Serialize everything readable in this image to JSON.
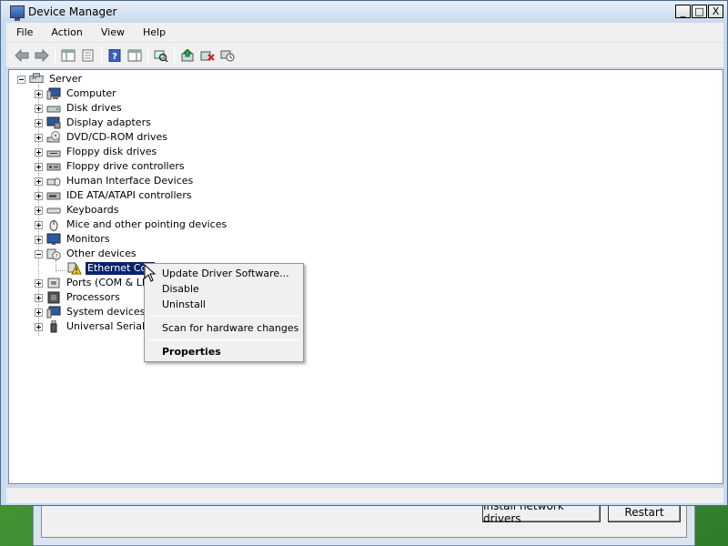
{
  "background_dialog": {
    "install_button": "Install network drivers",
    "restart_button": "Restart"
  },
  "window": {
    "title": "Device Manager",
    "controls": {
      "minimize": "_",
      "maximize": "□",
      "close": "X"
    }
  },
  "menubar": {
    "items": [
      "File",
      "Action",
      "View",
      "Help"
    ]
  },
  "toolbar": {
    "buttons": [
      "back-arrow-icon",
      "forward-arrow-icon",
      "show-hide-console-tree-icon",
      "properties-icon",
      "help-icon",
      "show-action-pane-icon",
      "scan-hardware-icon",
      "update-driver-icon",
      "uninstall-icon",
      "disable-device-icon"
    ]
  },
  "tree": {
    "root": "Server",
    "nodes": [
      {
        "label": "Computer",
        "icon": "computer-icon"
      },
      {
        "label": "Disk drives",
        "icon": "disk-drive-icon"
      },
      {
        "label": "Display adapters",
        "icon": "display-adapter-icon"
      },
      {
        "label": "DVD/CD-ROM drives",
        "icon": "dvd-drive-icon"
      },
      {
        "label": "Floppy disk drives",
        "icon": "floppy-disk-icon"
      },
      {
        "label": "Floppy drive controllers",
        "icon": "floppy-controller-icon"
      },
      {
        "label": "Human Interface Devices",
        "icon": "hid-icon"
      },
      {
        "label": "IDE ATA/ATAPI controllers",
        "icon": "ide-controller-icon"
      },
      {
        "label": "Keyboards",
        "icon": "keyboard-icon"
      },
      {
        "label": "Mice and other pointing devices",
        "icon": "mouse-icon"
      },
      {
        "label": "Monitors",
        "icon": "monitor-icon"
      },
      {
        "label": "Other devices",
        "icon": "other-devices-icon"
      },
      {
        "label": "Ethernet Con",
        "icon": "warning-device-icon",
        "selected": true
      },
      {
        "label": "Ports (COM & LPT",
        "icon": "port-icon"
      },
      {
        "label": "Processors",
        "icon": "processor-icon"
      },
      {
        "label": "System devices",
        "icon": "system-devices-icon"
      },
      {
        "label": "Universal Serial Bu",
        "icon": "usb-icon"
      }
    ]
  },
  "context_menu": {
    "update_driver": "Update Driver Software...",
    "disable": "Disable",
    "uninstall": "Uninstall",
    "scan": "Scan for hardware changes",
    "properties": "Properties"
  }
}
